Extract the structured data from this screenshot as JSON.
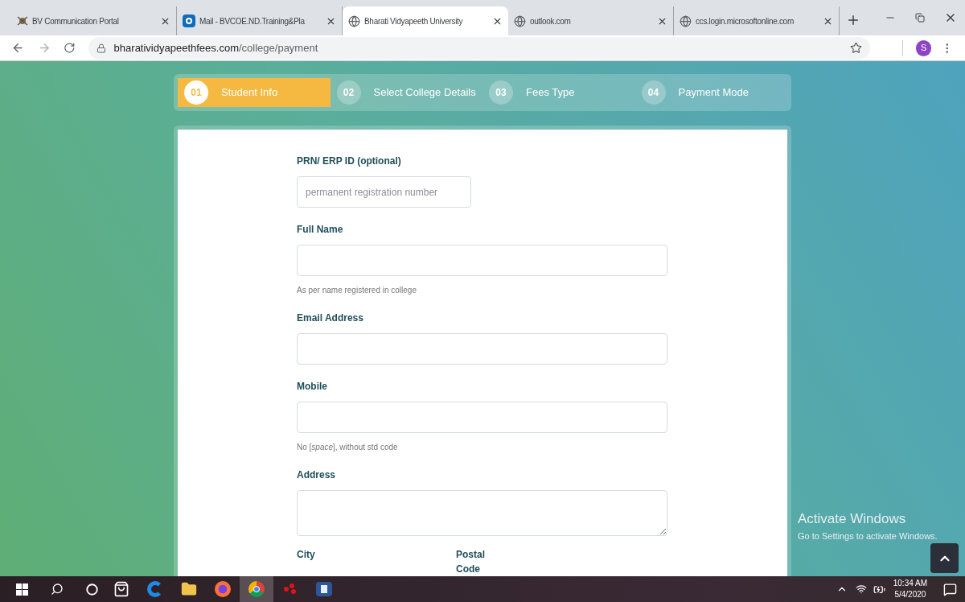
{
  "browser": {
    "tabs": [
      {
        "title": "BV Communication Portal",
        "kind": "portal",
        "selected": false
      },
      {
        "title": "Mail - BVCOE.ND.Training&Pla",
        "kind": "mail",
        "selected": false
      },
      {
        "title": "Bharati Vidyapeeth University",
        "kind": "web",
        "selected": true
      },
      {
        "title": "outlook.com",
        "kind": "web",
        "selected": false
      },
      {
        "title": "ccs.login.microsoftonline.com",
        "kind": "web",
        "selected": false
      }
    ],
    "url_host": "bharatividyapeethfees.com",
    "url_path": "/college/payment",
    "profile": "S"
  },
  "steps": [
    {
      "number": "01",
      "label": "Student Info",
      "selected": true
    },
    {
      "number": "02",
      "label": "Select College Details",
      "selected": false
    },
    {
      "number": "03",
      "label": "Fees Type",
      "selected": false
    },
    {
      "number": "04",
      "label": "Payment Mode",
      "selected": false
    }
  ],
  "form": {
    "fields": [
      {
        "kind": "short",
        "label": "PRN/ ERP ID (optional)",
        "placeholder": "permanent registration number"
      },
      {
        "kind": "input",
        "label": "Full Name",
        "help": "As per name registered in college"
      },
      {
        "kind": "input",
        "label": "Email Address"
      },
      {
        "kind": "input",
        "label": "Mobile",
        "help": "No [*space*], without std code"
      },
      {
        "kind": "textarea",
        "label": "Address"
      }
    ],
    "bottom_labels": [
      "City",
      "Postal Code"
    ]
  },
  "activation": {
    "title": "Activate Windows",
    "subtitle": "Go to Settings to activate Windows."
  },
  "taskbar": {
    "apps": [
      {
        "kind": "store",
        "selected": false
      },
      {
        "kind": "edge",
        "selected": false
      },
      {
        "kind": "folder",
        "selected": false
      },
      {
        "kind": "firefox",
        "selected": false
      },
      {
        "kind": "chrome",
        "selected": true
      },
      {
        "kind": "dots",
        "selected": false
      },
      {
        "kind": "word",
        "selected": false
      }
    ],
    "time": "10:34 AM",
    "date": "5/4/2020"
  }
}
